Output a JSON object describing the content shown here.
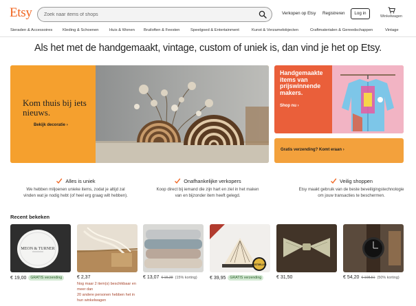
{
  "header": {
    "logo": "Etsy",
    "search_placeholder": "Zoek naar items of shops",
    "sell_label": "Verkopen op Etsy",
    "register_label": "Registreren",
    "signin_label": "Log in",
    "cart_label": "Winkelwagen"
  },
  "categories": [
    "Sieraden & Accessoires",
    "Kleding & Schoenen",
    "Huis & Wonen",
    "Bruiloften & Feesten",
    "Speelgoed & Entertainment",
    "Kunst & Verzamelobjecten",
    "Craftmaterialen & Gereedschappen",
    "Vintage"
  ],
  "tagline": "Als het met de handgemaakt, vintage, custom of uniek is, dan vind je het op Etsy.",
  "hero": {
    "title": "Kom thuis bij iets nieuws.",
    "cta": "Bekijk decoratie ›"
  },
  "promo": {
    "title": "Handgemaakte items van prijswinnende makers.",
    "cta": "Shop nu ›"
  },
  "shipping": {
    "label": "Gratis verzending? Komt eraan ›"
  },
  "value_props": [
    {
      "title": "Alles is uniek",
      "body": "We hebben miljoenen unieke items, zodat je altijd zal vinden wat je nodig hebt (of heel erg graag wilt hebben)."
    },
    {
      "title": "Onafhankelijke verkopers",
      "body": "Koop direct bij iemand die zijn hart en ziel in het maken van en bijzonder item heeft gelegd."
    },
    {
      "title": "Veilig shoppen",
      "body": "Etsy maakt gebruik van de beste beveiligingstechnologie om jouw transacties te beschermen."
    }
  ],
  "recent": {
    "title": "Recent bekeken",
    "items": [
      {
        "price": "€ 19,00",
        "badge": "GRATIS verzending",
        "old": "",
        "discount": "",
        "note1": "",
        "note2": ""
      },
      {
        "price": "€ 2,37",
        "badge": "",
        "old": "",
        "discount": "",
        "note1": "Nog maar 2 item(s) beschikbaar en meer dan",
        "note2": "20 andere personen hebben het in hun winkelwagen"
      },
      {
        "price": "€ 13,07",
        "badge": "",
        "old": "€ 15,38",
        "discount": "(15% korting)",
        "note1": "",
        "note2": ""
      },
      {
        "price": "€ 39,95",
        "badge": "GRATIS verzending",
        "old": "",
        "discount": "",
        "note1": "",
        "note2": ""
      },
      {
        "price": "€ 31,50",
        "badge": "",
        "old": "",
        "discount": "",
        "note1": "",
        "note2": ""
      },
      {
        "price": "€ 54,20",
        "badge": "",
        "old": "€ 108,51",
        "discount": "(50% korting)",
        "note1": "",
        "note2": ""
      }
    ]
  },
  "item_thumb_text": {
    "plate": "MEON & TURNER",
    "seal": "BESTSELLER"
  },
  "colors": {
    "brand": "#f1641e",
    "hero_bg": "#f5a02e",
    "promo_bg": "#ea5f3a",
    "shipping_bg": "#f3a13c",
    "badge_bg": "#d4e9d4"
  }
}
